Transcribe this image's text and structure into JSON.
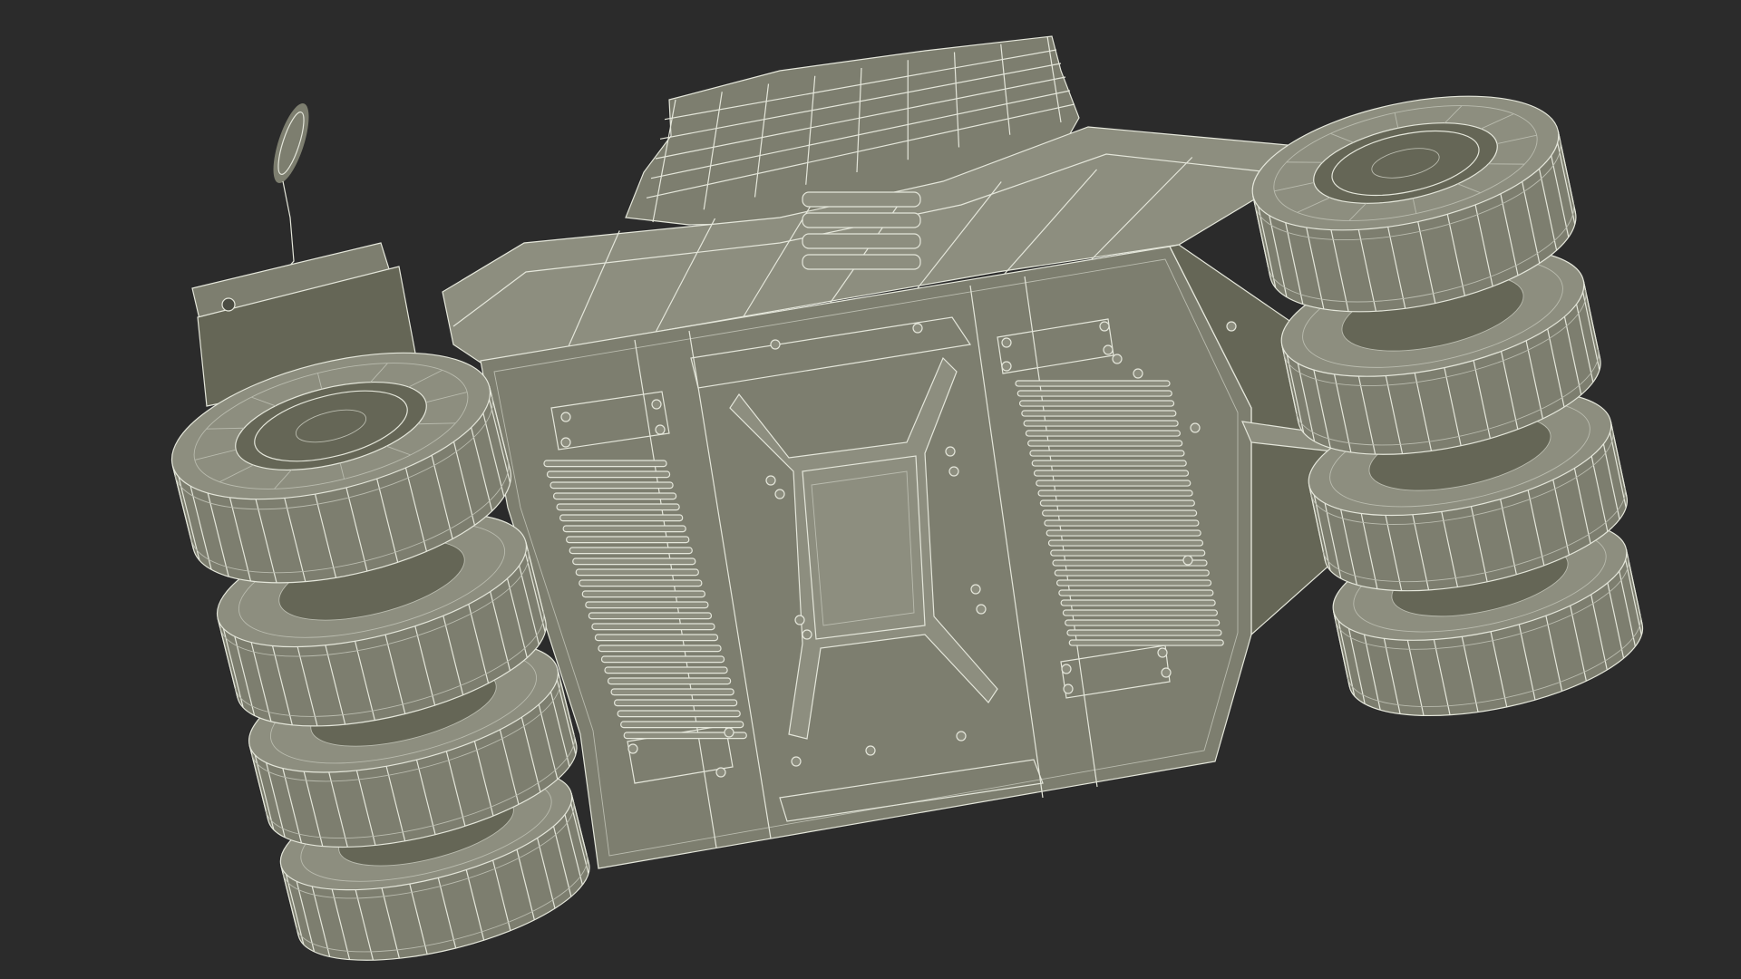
{
  "scene": {
    "subject": "vehicle-underside-wireframe-render",
    "background_color": "#2b2b2b",
    "model_fill": "#7d7e6f",
    "model_fill_dark": "#656656",
    "model_fill_light": "#8d8e7f",
    "wire_color": "#e4e6da",
    "wire_dim_color": "#b9bbae"
  }
}
